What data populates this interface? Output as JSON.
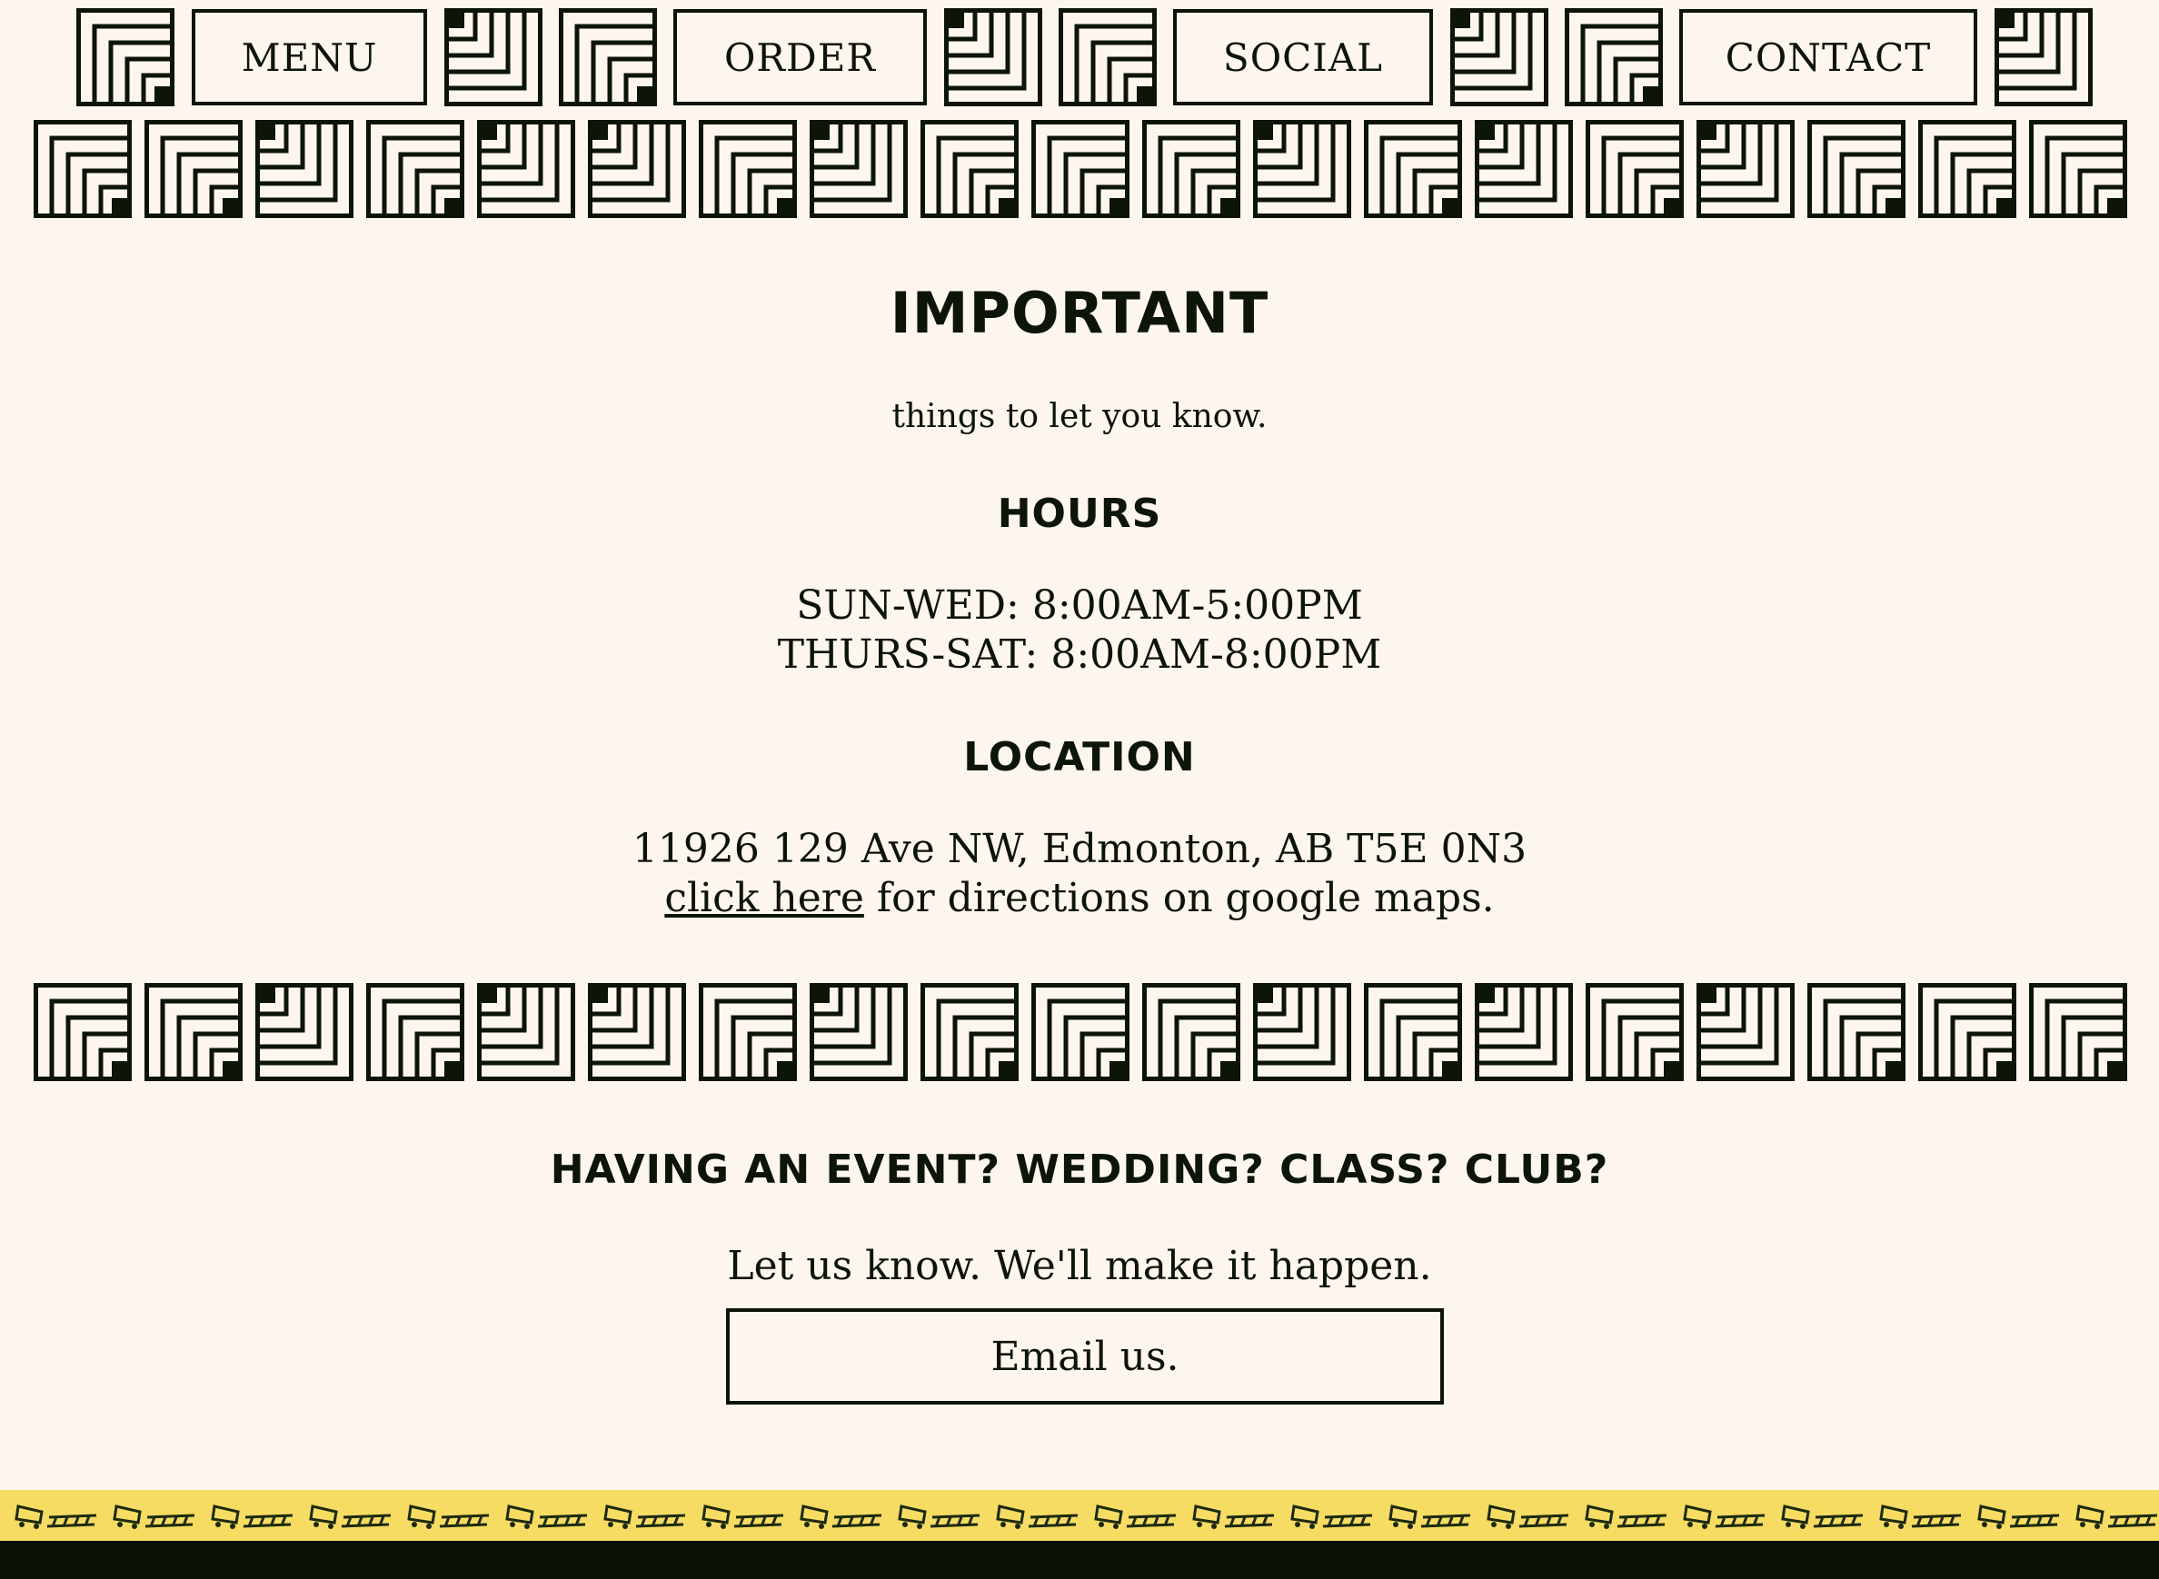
{
  "nav": {
    "items": [
      {
        "label": "MENU"
      },
      {
        "label": "ORDER"
      },
      {
        "label": "SOCIAL"
      },
      {
        "label": "CONTACT"
      }
    ]
  },
  "important": {
    "title": "IMPORTANT",
    "subtitle": "things to let you know."
  },
  "hours": {
    "title": "HOURS",
    "lines": [
      "SUN-WED: 8:00AM-5:00PM",
      "THURS-SAT: 8:00AM-8:00PM"
    ]
  },
  "location": {
    "title": "LOCATION",
    "address": "11926 129 Ave NW, Edmonton, AB T5E 0N3",
    "link_text": "click here",
    "link_suffix": " for directions on google maps."
  },
  "event": {
    "title": "HAVING AN EVENT? WEDDING? CLASS? CLUB?",
    "subtitle": "Let us know. We'll make it happen.",
    "button_label": "Email us."
  },
  "colors": {
    "background": "#fdf6ec",
    "ink": "#0d1408",
    "footer_band": "#f7dc63",
    "footer_bottom": "#0b1208"
  },
  "icons": {
    "tile": "maze-corner-tile-icon",
    "footer": "rail-car-icon"
  }
}
